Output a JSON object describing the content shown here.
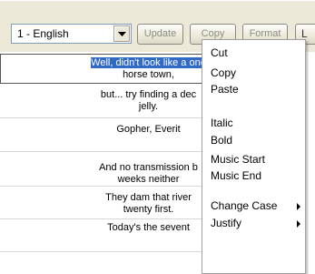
{
  "toolbar": {
    "language_value": "1 - English",
    "update_label": "Update",
    "copy_label": "Copy",
    "format_label": "Format",
    "next_partial_label": "L"
  },
  "grid": {
    "rows": [
      {
        "line1_selected": "Well, didn't look like a one",
        "line2": "horse town,"
      },
      {
        "line1": "but... try finding a dec",
        "line2": "jelly."
      },
      {
        "line1": "Gopher, Everit",
        "line2": ""
      },
      {
        "line1": "And no transmission b",
        "line2": "weeks neither"
      },
      {
        "line1": "They dam that river",
        "line2": "twenty first."
      },
      {
        "line1": "Today's the sevent",
        "line2": ""
      }
    ]
  },
  "context_menu": {
    "items": [
      {
        "label": "Cut"
      },
      {
        "label": "Copy"
      },
      {
        "label": "Paste"
      },
      {
        "label": "Italic"
      },
      {
        "label": "Bold"
      },
      {
        "label": "Music Start"
      },
      {
        "label": "Music End"
      },
      {
        "label": "Change Case"
      },
      {
        "label": "Justify"
      }
    ]
  }
}
